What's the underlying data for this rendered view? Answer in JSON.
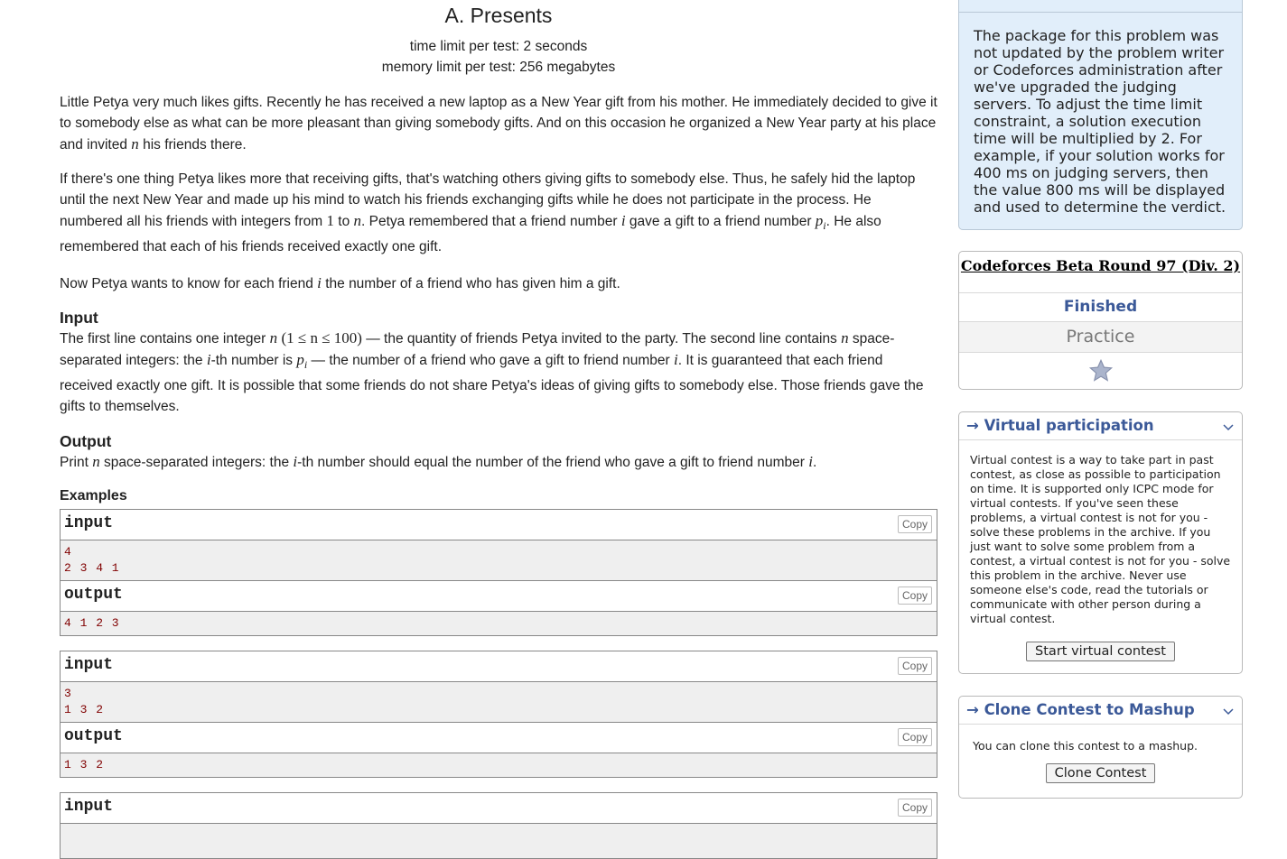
{
  "problem": {
    "title": "A. Presents",
    "time_limit": "time limit per test: 2 seconds",
    "memory_limit": "memory limit per test: 256 megabytes",
    "p1": {
      "a": "Little Petya very much likes gifts. Recently he has received a new laptop as a New Year gift from his mother. He immediately decided to give it to somebody else as what can be more pleasant than giving somebody gifts. And on this occasion he organized a New Year party at his place and invited ",
      "n": "n",
      "b": " his friends there."
    },
    "p2": {
      "a": "If there's one thing Petya likes more that receiving gifts, that's watching others giving gifts to somebody else. Thus, he safely hid the laptop until the next New Year and made up his mind to watch his friends exchanging gifts while he does not participate in the process. He numbered all his friends with integers from ",
      "one": "1",
      "to": " to ",
      "n": "n",
      "b": ". Petya remembered that a friend number ",
      "i": "i",
      "c": " gave a gift to a friend number ",
      "p": "p",
      "sub": "i",
      "d": ". He also remembered that each of his friends received exactly one gift."
    },
    "p3": {
      "a": "Now Petya wants to know for each friend ",
      "i": "i",
      "b": " the number of a friend who has given him a gift."
    },
    "input_title": "Input",
    "input": {
      "a": "The first line contains one integer ",
      "n": "n",
      "constraint": "(1 ≤ n ≤ 100)",
      "b": " — the quantity of friends Petya invited to the party. The second line contains ",
      "n2": "n",
      "c": " space-separated integers: the ",
      "i": "i",
      "d": "-th number is ",
      "p": "p",
      "sub": "i",
      "e": " — the number of a friend who gave a gift to friend number ",
      "i2": "i",
      "f": ". It is guaranteed that each friend received exactly one gift. It is possible that some friends do not share Petya's ideas of giving gifts to somebody else. Those friends gave the gifts to themselves."
    },
    "output_title": "Output",
    "output": {
      "a": "Print ",
      "n": "n",
      "b": " space-separated integers: the ",
      "i": "i",
      "c": "-th number should equal the number of the friend who gave a gift to friend number ",
      "i2": "i",
      "d": "."
    },
    "examples_title": "Examples",
    "input_label": "input",
    "output_label": "output",
    "copy_label": "Copy",
    "samples": [
      {
        "input_lines": [
          "4",
          "2 3 4 1"
        ],
        "output_lines": [
          "4 1 2 3"
        ]
      },
      {
        "input_lines": [
          "3",
          "1 3 2"
        ],
        "output_lines": [
          "1 3 2"
        ]
      }
    ]
  },
  "sidebar": {
    "attention_text": "The package for this problem was not updated by the problem writer or Codeforces administration after we've upgraded the judging servers. To adjust the time limit constraint, a solution execution time will be multiplied by 2. For example, if your solution works for 400 ms on judging servers, then the value 800 ms will be displayed and used to determine the verdict.",
    "contest_name": "Codeforces Beta Round 97 (Div. 2)",
    "contest_status": "Finished",
    "contest_mode": "Practice",
    "virtual_title": "→ Virtual participation",
    "virtual_text": "Virtual contest is a way to take part in past contest, as close as possible to participation on time. It is supported only ICPC mode for virtual contests. If you've seen these problems, a virtual contest is not for you - solve these problems in the archive. If you just want to solve some problem from a contest, a virtual contest is not for you - solve this problem in the archive. Never use someone else's code, read the tutorials or communicate with other person during a virtual contest.",
    "virtual_button": "Start virtual contest",
    "clone_title": "→ Clone Contest to Mashup",
    "clone_text": "You can clone this contest to a mashup.",
    "clone_button": "Clone Contest"
  },
  "colors": {
    "accent": "#3b5998",
    "sample_text": "#800000",
    "attention_bg": "#e1eefa"
  }
}
